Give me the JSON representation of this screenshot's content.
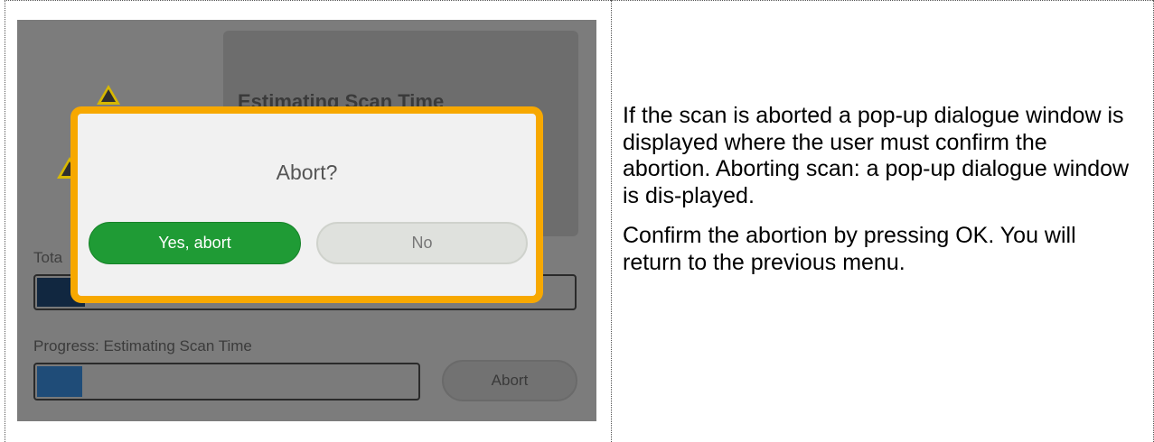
{
  "device_screen": {
    "background_panel": {
      "title": "Estimating Scan Time"
    },
    "total_label": "Tota",
    "total_progress": 0.09,
    "progress_label": "Progress: Estimating Scan Time",
    "progress_value": 0.12,
    "abort_button_label": "Abort",
    "dialog": {
      "title": "Abort?",
      "yes_label": "Yes, abort",
      "no_label": "No",
      "border_color": "#f7a800",
      "yes_color": "#1f9b35"
    }
  },
  "description": {
    "paragraph_1": "If the scan is aborted a pop-up dialogue window is displayed where the user must confirm the abortion. Aborting scan: a pop-up dialogue window is dis-played.",
    "paragraph_2": "Confirm the abortion by pressing OK. You will return to the previous menu."
  }
}
